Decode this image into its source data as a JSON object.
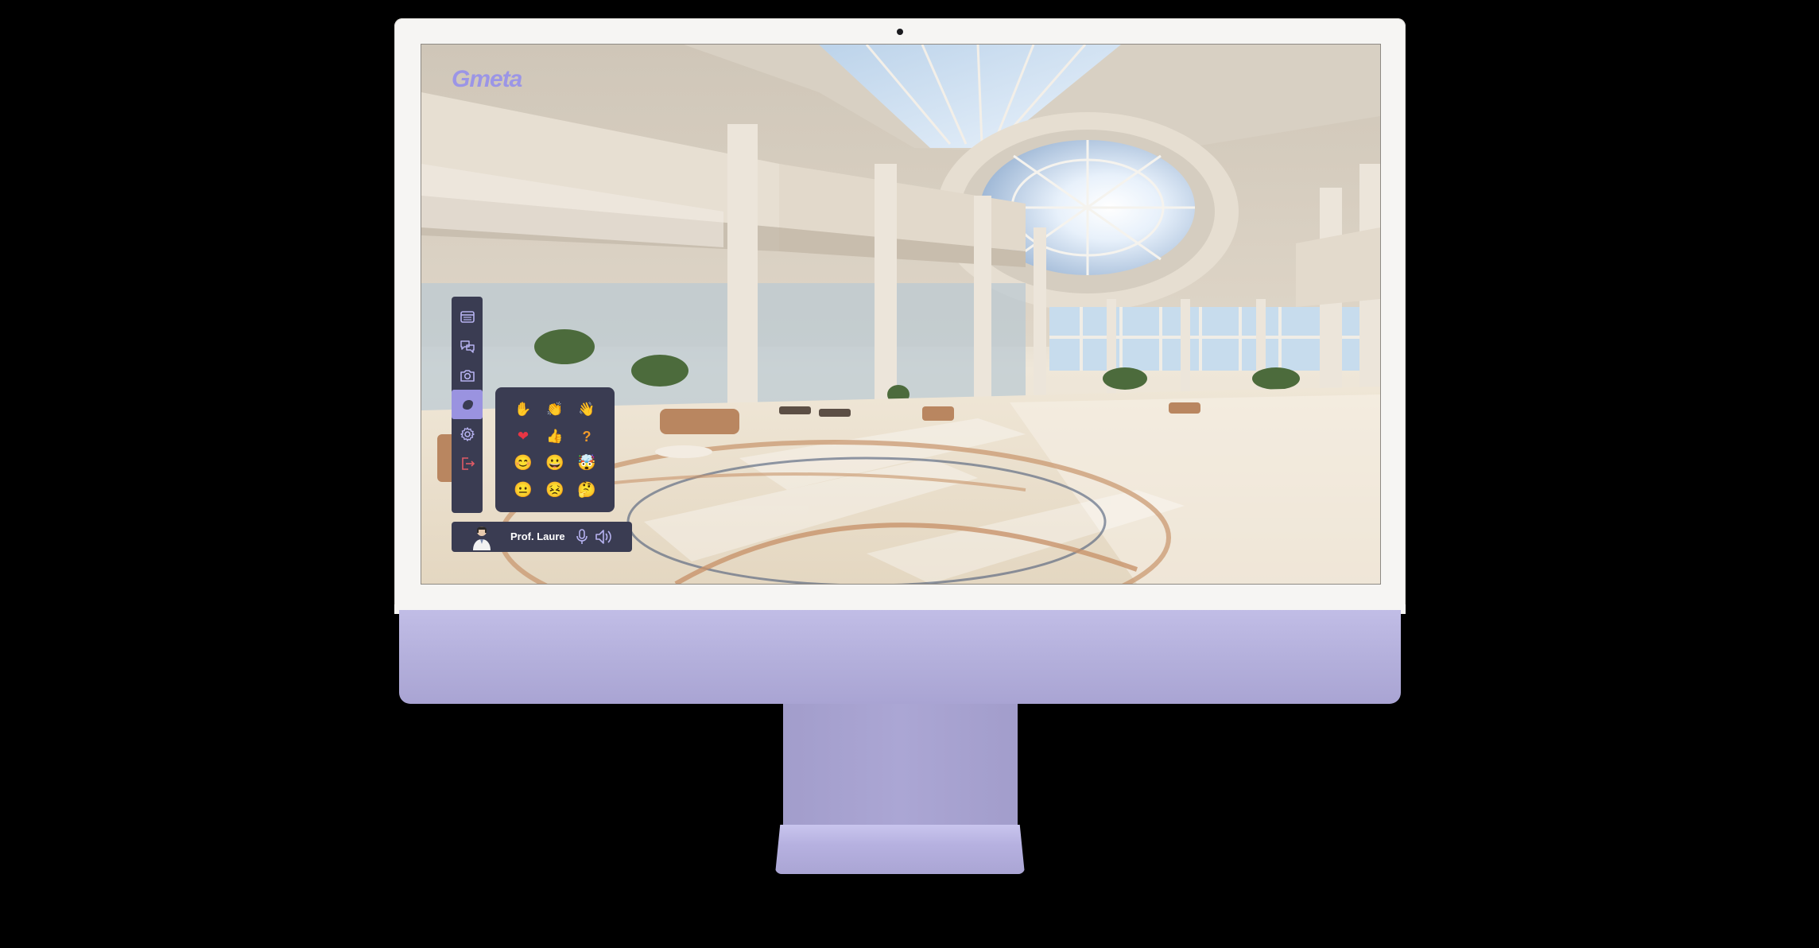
{
  "app": {
    "logo_text": "Gmeta",
    "accent_color": "#9b95e6",
    "panel_color": "#3a3c52"
  },
  "toolbar": {
    "items": [
      {
        "name": "calendar",
        "icon": "calendar-icon"
      },
      {
        "name": "chat",
        "icon": "chat-bubbles-icon"
      },
      {
        "name": "camera",
        "icon": "camera-icon"
      },
      {
        "name": "reactions",
        "icon": "hand-icon",
        "active": true
      },
      {
        "name": "settings",
        "icon": "gear-icon"
      },
      {
        "name": "logout",
        "icon": "logout-icon",
        "color": "#e05b66"
      }
    ]
  },
  "reactions": {
    "items": [
      {
        "icon": "raise-hand-icon",
        "glyph": "✋"
      },
      {
        "icon": "clap-icon",
        "glyph": "👏"
      },
      {
        "icon": "wave-icon",
        "glyph": "👋"
      },
      {
        "icon": "heart-icon",
        "glyph": "❤"
      },
      {
        "icon": "thumbs-up-icon",
        "glyph": "👍"
      },
      {
        "icon": "question-mark-icon",
        "glyph": "?"
      },
      {
        "icon": "smile-emoji-icon",
        "glyph": "😊"
      },
      {
        "icon": "grin-emoji-icon",
        "glyph": "😀"
      },
      {
        "icon": "mind-blown-emoji-icon",
        "glyph": "🤯"
      },
      {
        "icon": "neutral-emoji-icon",
        "glyph": "😐"
      },
      {
        "icon": "tired-emoji-icon",
        "glyph": "😣"
      },
      {
        "icon": "thinking-emoji-icon",
        "glyph": "🤔"
      }
    ]
  },
  "user": {
    "name": "Prof. Laure",
    "mic_icon": "microphone-icon",
    "speaker_icon": "speaker-icon"
  }
}
